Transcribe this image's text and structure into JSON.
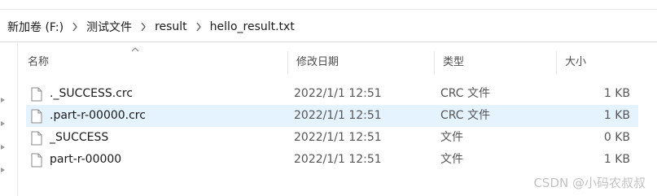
{
  "breadcrumb": {
    "items": [
      "新加卷 (F:)",
      "测试文件",
      "result",
      "hello_result.txt"
    ]
  },
  "columns": {
    "name": "名称",
    "date": "修改日期",
    "type": "类型",
    "size": "大小"
  },
  "files": [
    {
      "name": "._SUCCESS.crc",
      "date": "2022/1/1 12:51",
      "type": "CRC 文件",
      "size": "1 KB",
      "selected": false,
      "icon": "file-icon"
    },
    {
      "name": ".part-r-00000.crc",
      "date": "2022/1/1 12:51",
      "type": "CRC 文件",
      "size": "1 KB",
      "selected": true,
      "icon": "file-icon"
    },
    {
      "name": "_SUCCESS",
      "date": "2022/1/1 12:51",
      "type": "文件",
      "size": "0 KB",
      "selected": false,
      "icon": "file-icon"
    },
    {
      "name": "part-r-00000",
      "date": "2022/1/1 12:51",
      "type": "文件",
      "size": "1 KB",
      "selected": false,
      "icon": "file-icon"
    }
  ],
  "watermark": "CSDN @小码农叔叔",
  "colors": {
    "selected_row": "#e5f3ff",
    "header_text": "#4d4d4d",
    "watermark": "#c2c2c2"
  }
}
